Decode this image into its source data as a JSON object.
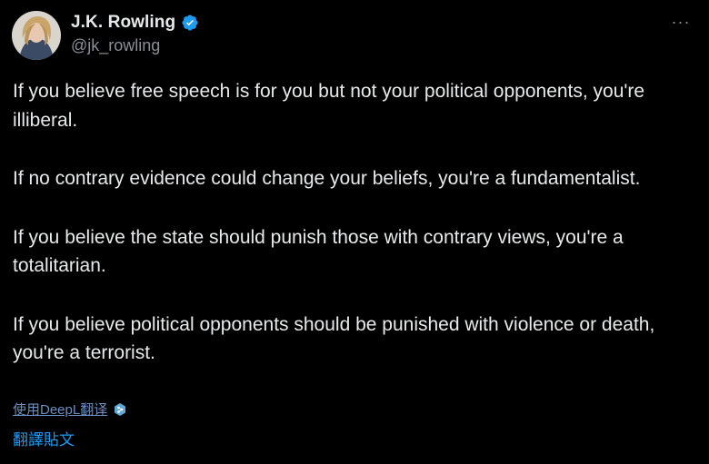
{
  "author": {
    "display_name": "J.K. Rowling",
    "handle": "@jk_rowling",
    "verified_icon": "verified-badge-icon",
    "avatar_icon": "profile-photo"
  },
  "menu": {
    "more_label": "···"
  },
  "tweet": {
    "paragraphs": [
      "If you believe free speech is for you but not your political opponents, you're illiberal.",
      "If no contrary evidence could change your beliefs, you're a fundamentalist.",
      "If you believe the state should punish those with contrary views, you're a totalitarian.",
      "If you believe political opponents should be punished with violence or death, you're a terrorist."
    ]
  },
  "translation": {
    "deepl_link": "使用DeepL翻译",
    "deepl_icon": "deepl-logo-icon",
    "translate_post": "翻譯貼文"
  },
  "colors": {
    "background": "#000000",
    "text": "#e7e9ea",
    "secondary": "#8b9096",
    "link": "#1d9bf0",
    "verified": "#1d9bf0"
  }
}
